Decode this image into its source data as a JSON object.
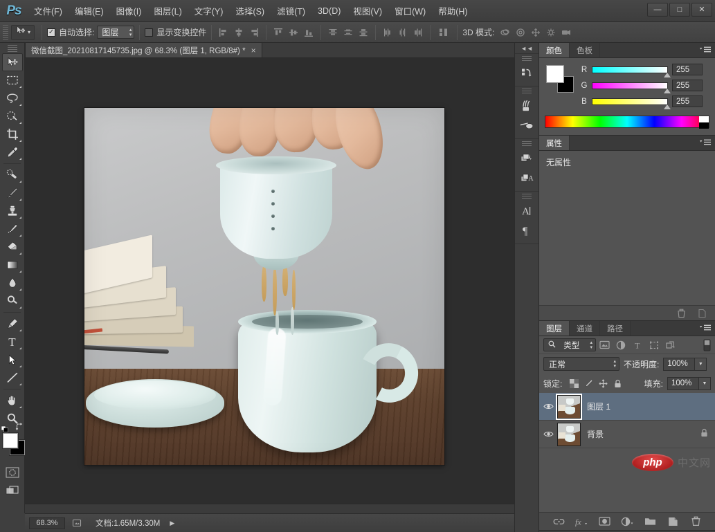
{
  "app": {
    "logo": "Ps",
    "menus": [
      {
        "label": "文件(F)"
      },
      {
        "label": "编辑(E)"
      },
      {
        "label": "图像(I)"
      },
      {
        "label": "图层(L)"
      },
      {
        "label": "文字(Y)"
      },
      {
        "label": "选择(S)"
      },
      {
        "label": "滤镜(T)"
      },
      {
        "label": "3D(D)"
      },
      {
        "label": "视图(V)"
      },
      {
        "label": "窗口(W)"
      },
      {
        "label": "帮助(H)"
      }
    ],
    "window_controls": {
      "minimize": "—",
      "maximize": "□",
      "close": "✕"
    }
  },
  "options_bar": {
    "tool_icon": "move-tool-icon",
    "auto_select_checked": true,
    "auto_select_label": "自动选择:",
    "auto_select_value": "图层",
    "show_transform_label": "显示变换控件",
    "show_transform_checked": false,
    "mode3d_label": "3D 模式:",
    "align_icons": [
      "align-left-edges",
      "align-horizontal-centers",
      "align-right-edges",
      "align-top-edges",
      "align-vertical-centers",
      "align-bottom-edges"
    ],
    "distribute_icons": [
      "distribute-top-edges",
      "distribute-vertical-centers",
      "distribute-bottom-edges",
      "distribute-left-edges",
      "distribute-horizontal-centers",
      "distribute-right-edges"
    ],
    "auto_align_icon": "auto-align-layers-icon",
    "mode3d_icons": [
      "rotate-3d-object",
      "roll-3d-object",
      "drag-3d-object",
      "slide-3d-object",
      "scale-3d-camera"
    ]
  },
  "document": {
    "tab_title": "微信截图_20210817145735.jpg @ 68.3% (图层 1, RGB/8#) *",
    "close_glyph": "×"
  },
  "toolbar": {
    "tools": [
      {
        "name": "move-tool",
        "active": true,
        "has_flyout": false
      },
      {
        "name": "rectangular-marquee-tool",
        "active": false,
        "has_flyout": true
      },
      {
        "name": "lasso-tool",
        "active": false,
        "has_flyout": true
      },
      {
        "name": "quick-selection-tool",
        "active": false,
        "has_flyout": true
      },
      {
        "name": "crop-tool",
        "active": false,
        "has_flyout": true
      },
      {
        "name": "eyedropper-tool",
        "active": false,
        "has_flyout": true
      },
      {
        "name": "spot-healing-brush-tool",
        "active": false,
        "has_flyout": true
      },
      {
        "name": "brush-tool",
        "active": false,
        "has_flyout": true
      },
      {
        "name": "clone-stamp-tool",
        "active": false,
        "has_flyout": true
      },
      {
        "name": "history-brush-tool",
        "active": false,
        "has_flyout": true
      },
      {
        "name": "eraser-tool",
        "active": false,
        "has_flyout": true
      },
      {
        "name": "gradient-tool",
        "active": false,
        "has_flyout": true
      },
      {
        "name": "blur-tool",
        "active": false,
        "has_flyout": true
      },
      {
        "name": "dodge-tool",
        "active": false,
        "has_flyout": true
      },
      {
        "name": "pen-tool",
        "active": false,
        "has_flyout": true
      },
      {
        "name": "horizontal-type-tool",
        "active": false,
        "has_flyout": true,
        "glyph": "T"
      },
      {
        "name": "path-selection-tool",
        "active": false,
        "has_flyout": true
      },
      {
        "name": "line-tool",
        "active": false,
        "has_flyout": true
      },
      {
        "name": "hand-tool",
        "active": false,
        "has_flyout": true
      },
      {
        "name": "zoom-tool",
        "active": false,
        "has_flyout": false
      }
    ],
    "foreground_color": "#ffffff",
    "background_color": "#000000",
    "quick_mask_name": "edit-in-quick-mask-mode",
    "screen_mode_name": "change-screen-mode"
  },
  "mini_dock": {
    "collapse_glyph": "◄◄",
    "buttons": [
      {
        "name": "history-panel-icon"
      },
      {
        "name": "brush-panel-icon"
      },
      {
        "name": "brush-presets-panel-icon"
      },
      {
        "name": "layer-comps-panel-icon"
      },
      {
        "name": "adjustments-panel-icon"
      },
      {
        "name": "character-panel-icon"
      },
      {
        "name": "paragraph-panel-icon"
      }
    ]
  },
  "color_panel": {
    "tabs": [
      {
        "label": "颜色",
        "active": true
      },
      {
        "label": "色板",
        "active": false
      }
    ],
    "channels": [
      {
        "label": "R",
        "value": "255"
      },
      {
        "label": "G",
        "value": "255"
      },
      {
        "label": "B",
        "value": "255"
      }
    ],
    "foreground": "#ffffff",
    "background": "#000000"
  },
  "properties_panel": {
    "tabs": [
      {
        "label": "属性",
        "active": true
      }
    ],
    "empty_message": "无属性"
  },
  "layers_panel": {
    "tabs": [
      {
        "label": "图层",
        "active": true
      },
      {
        "label": "通道",
        "active": false
      },
      {
        "label": "路径",
        "active": false
      }
    ],
    "filter": {
      "search_icon": "search-icon",
      "type_label": "类型",
      "filter_icons": [
        "filter-pixel-layers-icon",
        "filter-adjustment-layers-icon",
        "filter-type-layers-icon",
        "filter-shape-layers-icon",
        "filter-smart-objects-icon"
      ],
      "toggle_name": "filter-toggle-switch"
    },
    "blend_mode": "正常",
    "opacity_label": "不透明度:",
    "opacity_value": "100%",
    "lock_label": "锁定:",
    "lock_icons": [
      "lock-transparent-pixels-icon",
      "lock-image-pixels-icon",
      "lock-position-icon",
      "lock-all-icon"
    ],
    "fill_label": "填充:",
    "fill_value": "100%",
    "layers": [
      {
        "name": "图层 1",
        "visible": true,
        "selected": true,
        "locked": false
      },
      {
        "name": "背景",
        "visible": true,
        "selected": false,
        "locked": true
      }
    ],
    "footer_buttons": [
      {
        "name": "link-layers-button",
        "glyph": "🔗"
      },
      {
        "name": "add-layer-style-button",
        "glyph": "fx"
      },
      {
        "name": "add-layer-mask-button",
        "glyph": "mask"
      },
      {
        "name": "new-fill-adjustment-layer-button",
        "glyph": "half-circle"
      },
      {
        "name": "new-group-button",
        "glyph": "folder"
      },
      {
        "name": "new-layer-button",
        "glyph": "page"
      },
      {
        "name": "delete-layer-button",
        "glyph": "trash"
      }
    ],
    "panel_top_buttons": [
      {
        "name": "delete-panel-button"
      },
      {
        "name": "new-panel-button"
      }
    ]
  },
  "status_bar": {
    "zoom": "68.3%",
    "preview_icon": "document-preview-icon",
    "doc_info": "文档:1.65M/3.30M",
    "arrow_glyph": "▶"
  },
  "watermark": {
    "logo_text": "php",
    "site_text": "中文网",
    "logo_color": "#c02222"
  },
  "canvas": {
    "image_description": "手持青瓷茶漏滤茶入杯",
    "background_color": "#2d2d2d"
  }
}
